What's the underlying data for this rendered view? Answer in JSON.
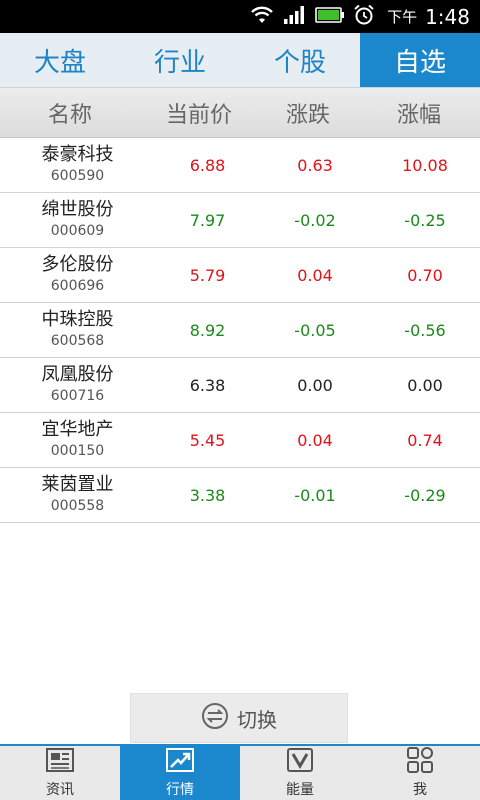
{
  "status_bar": {
    "ampm": "下午",
    "time": "1:48",
    "icons": [
      "wifi-icon",
      "signal-icon",
      "battery-icon",
      "alarm-icon"
    ]
  },
  "top_tabs": [
    {
      "label": "大盘",
      "active": false
    },
    {
      "label": "行业",
      "active": false
    },
    {
      "label": "个股",
      "active": false
    },
    {
      "label": "自选",
      "active": true
    }
  ],
  "columns": {
    "name": "名称",
    "price": "当前价",
    "change": "涨跌",
    "percent": "涨幅"
  },
  "stocks": [
    {
      "name": "泰豪科技",
      "code": "600590",
      "price": "6.88",
      "change": "0.63",
      "percent": "10.08",
      "trend": "up"
    },
    {
      "name": "绵世股份",
      "code": "000609",
      "price": "7.97",
      "change": "-0.02",
      "percent": "-0.25",
      "trend": "down"
    },
    {
      "name": "多伦股份",
      "code": "600696",
      "price": "5.79",
      "change": "0.04",
      "percent": "0.70",
      "trend": "up"
    },
    {
      "name": "中珠控股",
      "code": "600568",
      "price": "8.92",
      "change": "-0.05",
      "percent": "-0.56",
      "trend": "down"
    },
    {
      "name": "凤凰股份",
      "code": "600716",
      "price": "6.38",
      "change": "0.00",
      "percent": "0.00",
      "trend": "flat"
    },
    {
      "name": "宜华地产",
      "code": "000150",
      "price": "5.45",
      "change": "0.04",
      "percent": "0.74",
      "trend": "up"
    },
    {
      "name": "莱茵置业",
      "code": "000558",
      "price": "3.38",
      "change": "-0.01",
      "percent": "-0.29",
      "trend": "down"
    }
  ],
  "switch_button": {
    "label": "切换",
    "icon": "swap-icon"
  },
  "bottom_nav": [
    {
      "label": "资讯",
      "icon": "news-icon",
      "active": false
    },
    {
      "label": "行情",
      "icon": "chart-trend-icon",
      "active": true
    },
    {
      "label": "能量",
      "icon": "energy-icon",
      "active": false
    },
    {
      "label": "我",
      "icon": "grid-icon",
      "active": false
    }
  ],
  "colors": {
    "accent": "#1b87cc",
    "up": "#e0121a",
    "down": "#1a8a1a",
    "flat": "#222222"
  }
}
